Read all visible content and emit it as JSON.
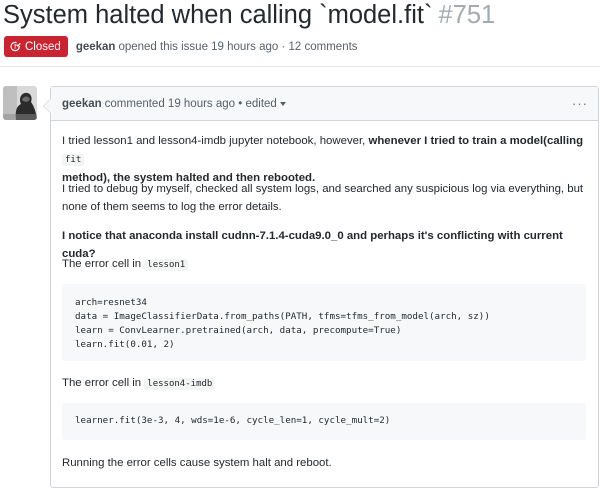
{
  "issue": {
    "title": "System halted when calling `model.fit`",
    "number": "#751",
    "status": "Closed",
    "author": "geekan",
    "meta_text": "opened this issue 19 hours ago · 12 comments"
  },
  "comment": {
    "author": "geekan",
    "header_text": "commented 19 hours ago • edited",
    "more_label": "···",
    "p1_plain": "I tried lesson1 and lesson4-imdb jupyter notebook, however, ",
    "p1_bold_start": "whenever I tried to train a model(calling ",
    "p1_code": "fit",
    "p1_bold_end": "method), the system halted and then rebooted.",
    "p2": "I tried to debug by myself, checked all system logs, and searched any suspicious log via everything, but none of them seems to log the error details.",
    "p3": "I notice that anaconda install cudnn-7.1.4-cuda9.0_0 and perhaps it's conflicting with current cuda?",
    "p4_text": "The error cell in ",
    "p4_code": "lesson1",
    "code_block_1": [
      "arch=resnet34",
      "data = ImageClassifierData.from_paths(PATH, tfms=tfms_from_model(arch, sz))",
      "learn = ConvLearner.pretrained(arch, data, precompute=True)",
      "learn.fit(0.01, 2)"
    ],
    "p5_text": "The error cell in ",
    "p5_code": "lesson4-imdb",
    "code_block_2": [
      "learner.fit(3e-3, 4, wds=1e-6, cycle_len=1, cycle_mult=2)"
    ],
    "p6": "Running the error cells cause system halt and reboot."
  },
  "colors": {
    "closed_badge": "#cb2431",
    "issue_number": "#a3aab1",
    "header_bg": "#f6f8fa",
    "code_bg": "#f6f8fa"
  }
}
